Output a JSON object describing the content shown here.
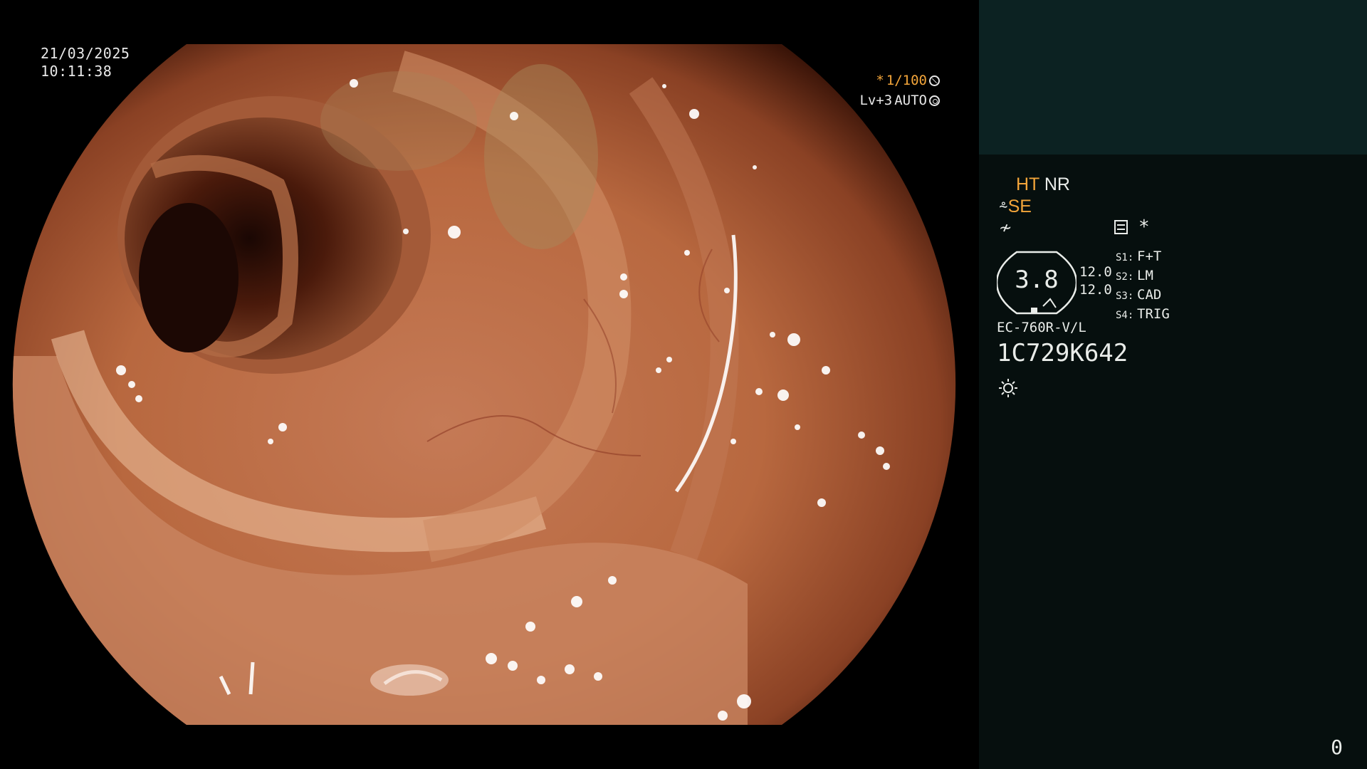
{
  "overlay": {
    "date": "21/03/2025",
    "time": "10:11:38",
    "shutter_prefix": "*",
    "shutter": "1/100",
    "level": "Lv+3",
    "mode": "AUTO"
  },
  "panel": {
    "ht": "HT",
    "nr": "NR",
    "se": "SE",
    "star": "*",
    "zoom": "3.8",
    "gain_1": "12.0",
    "gain_2": "12.0",
    "switches": [
      {
        "key": "S1:",
        "label": "F+T"
      },
      {
        "key": "S2:",
        "label": "LM"
      },
      {
        "key": "S3:",
        "label": "CAD"
      },
      {
        "key": "S4:",
        "label": "TRIG"
      }
    ],
    "scope_model": "EC-760R-V/L",
    "serial": "1C729K642",
    "counter": "0"
  },
  "colors": {
    "panel_bg": "#060f0e",
    "header_bg": "#0c2222",
    "accent": "#f3a53a",
    "text": "#e9ece9"
  }
}
